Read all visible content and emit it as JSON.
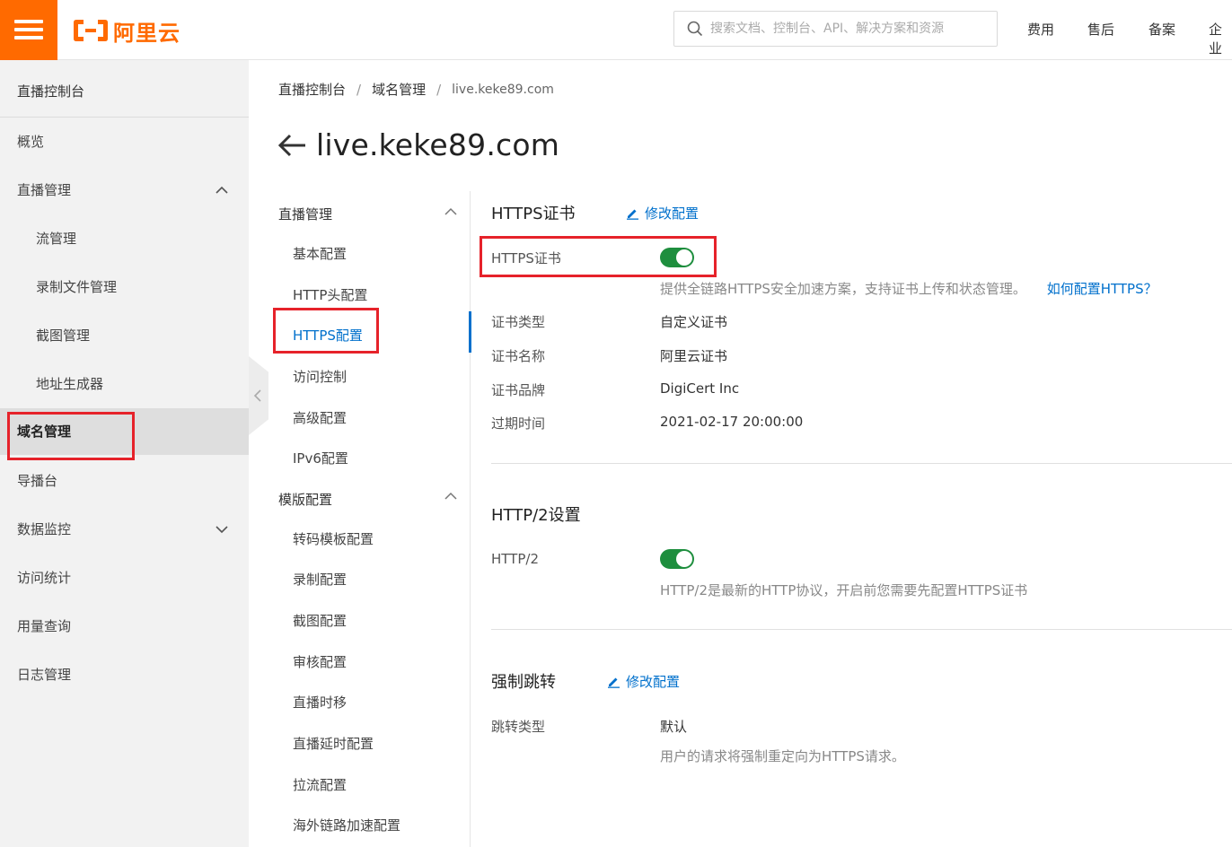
{
  "header": {
    "logo_text": "阿里云",
    "search_placeholder": "搜索文档、控制台、API、解决方案和资源",
    "nav": [
      "费用",
      "售后",
      "备案",
      "企业"
    ],
    "brand_color": "#ff6a00"
  },
  "sidebar": {
    "title": "直播控制台",
    "items": [
      {
        "label": "概览"
      },
      {
        "label": "直播管理"
      },
      {
        "label": "流管理"
      },
      {
        "label": "录制文件管理"
      },
      {
        "label": "截图管理"
      },
      {
        "label": "地址生成器"
      },
      {
        "label": "域名管理"
      },
      {
        "label": "导播台"
      },
      {
        "label": "数据监控"
      },
      {
        "label": "访问统计"
      },
      {
        "label": "用量查询"
      },
      {
        "label": "日志管理"
      }
    ]
  },
  "breadcrumb": [
    "直播控制台",
    "域名管理",
    "live.keke89.com"
  ],
  "page_title": "live.keke89.com",
  "submenu": {
    "group1": "直播管理",
    "group1_items": [
      "基本配置",
      "HTTP头配置",
      "HTTPS配置",
      "访问控制",
      "高级配置",
      "IPv6配置"
    ],
    "group2": "模版配置",
    "group2_items": [
      "转码模板配置",
      "录制配置",
      "截图配置",
      "审核配置",
      "直播时移",
      "直播延时配置",
      "拉流配置",
      "海外链路加速配置"
    ]
  },
  "https": {
    "title": "HTTPS证书",
    "edit_label": "修改配置",
    "toggle_label": "HTTPS证书",
    "hint": "提供全链路HTTPS安全加速方案，支持证书上传和状态管理。",
    "help_link": "如何配置HTTPS？",
    "fields": [
      {
        "label": "证书类型",
        "value": "自定义证书"
      },
      {
        "label": "证书名称",
        "value": "阿里云证书"
      },
      {
        "label": "证书品牌",
        "value": "DigiCert Inc"
      },
      {
        "label": "过期时间",
        "value": "2021-02-17 20:00:00"
      }
    ]
  },
  "http2": {
    "title": "HTTP/2设置",
    "toggle_label": "HTTP/2",
    "hint": "HTTP/2是最新的HTTP协议，开启前您需要先配置HTTPS证书"
  },
  "redirect": {
    "title": "强制跳转",
    "edit_label": "修改配置",
    "type_label": "跳转类型",
    "type_value": "默认",
    "hint": "用户的请求将强制重定向为HTTPS请求。"
  },
  "colors": {
    "accent": "#0070cc",
    "toggle_on": "#1e8e3e",
    "highlight": "#e6222a"
  }
}
